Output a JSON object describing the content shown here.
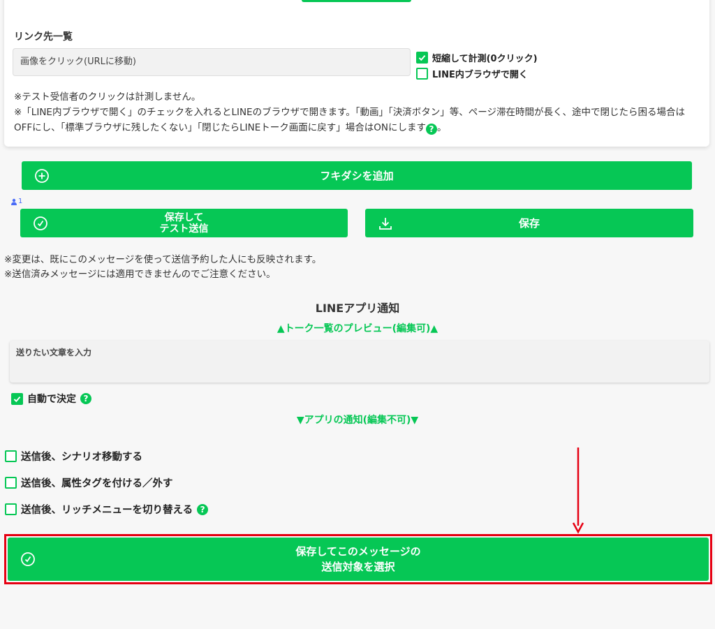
{
  "link_section": {
    "title": "リンク先一覧",
    "url_field_value": "画像をクリック(URLに移動)",
    "options": [
      {
        "label": "短縮して計測(0クリック)",
        "checked": true
      },
      {
        "label": "LINE内ブラウザで開く",
        "checked": false
      }
    ],
    "note_1": "※テスト受信者のクリックは計測しません。",
    "note_2": "※「LINE内ブラウザで開く」のチェックを入れるとLINEのブラウザで開きます。「動画」「決済ボタン」等、ページ滞在時間が長く、途中で閉じたら困る場合はOFFにし、「標準ブラウザに残したくない」「閉じたらLINEトーク画面に戻す」場合はONにします",
    "note_2_end": "。"
  },
  "add_bubble_button": "フキダシを追加",
  "test_user_count": "1",
  "save_test_button": {
    "line1": "保存して",
    "line2": "テスト送信"
  },
  "save_button": "保存",
  "notes": [
    "※変更は、既にこのメッセージを使って送信予約した人にも反映されます。",
    "※送信済みメッセージには適用できませんのでご注意ください。"
  ],
  "notification": {
    "title": "LINEアプリ通知",
    "preview_label": "▲トーク一覧のプレビュー(編集可)▲",
    "input_placeholder": "送りたい文章を入力",
    "auto_decide_label": "自動で決定",
    "auto_decide_checked": true,
    "app_notice_label": "▼アプリの通知(編集不可)▼"
  },
  "after_send_options": [
    {
      "label": "送信後、シナリオ移動する",
      "checked": false,
      "help": false
    },
    {
      "label": "送信後、属性タグを付ける／外す",
      "checked": false,
      "help": false
    },
    {
      "label": "送信後、リッチメニューを切り替える",
      "checked": false,
      "help": true
    }
  ],
  "final_button": {
    "line1": "保存してこのメッセージの",
    "line2": "送信対象を選択"
  },
  "colors": {
    "accent": "#06c755",
    "highlight": "#e60012",
    "badge": "#4a6cf7"
  },
  "help_glyph": "?"
}
